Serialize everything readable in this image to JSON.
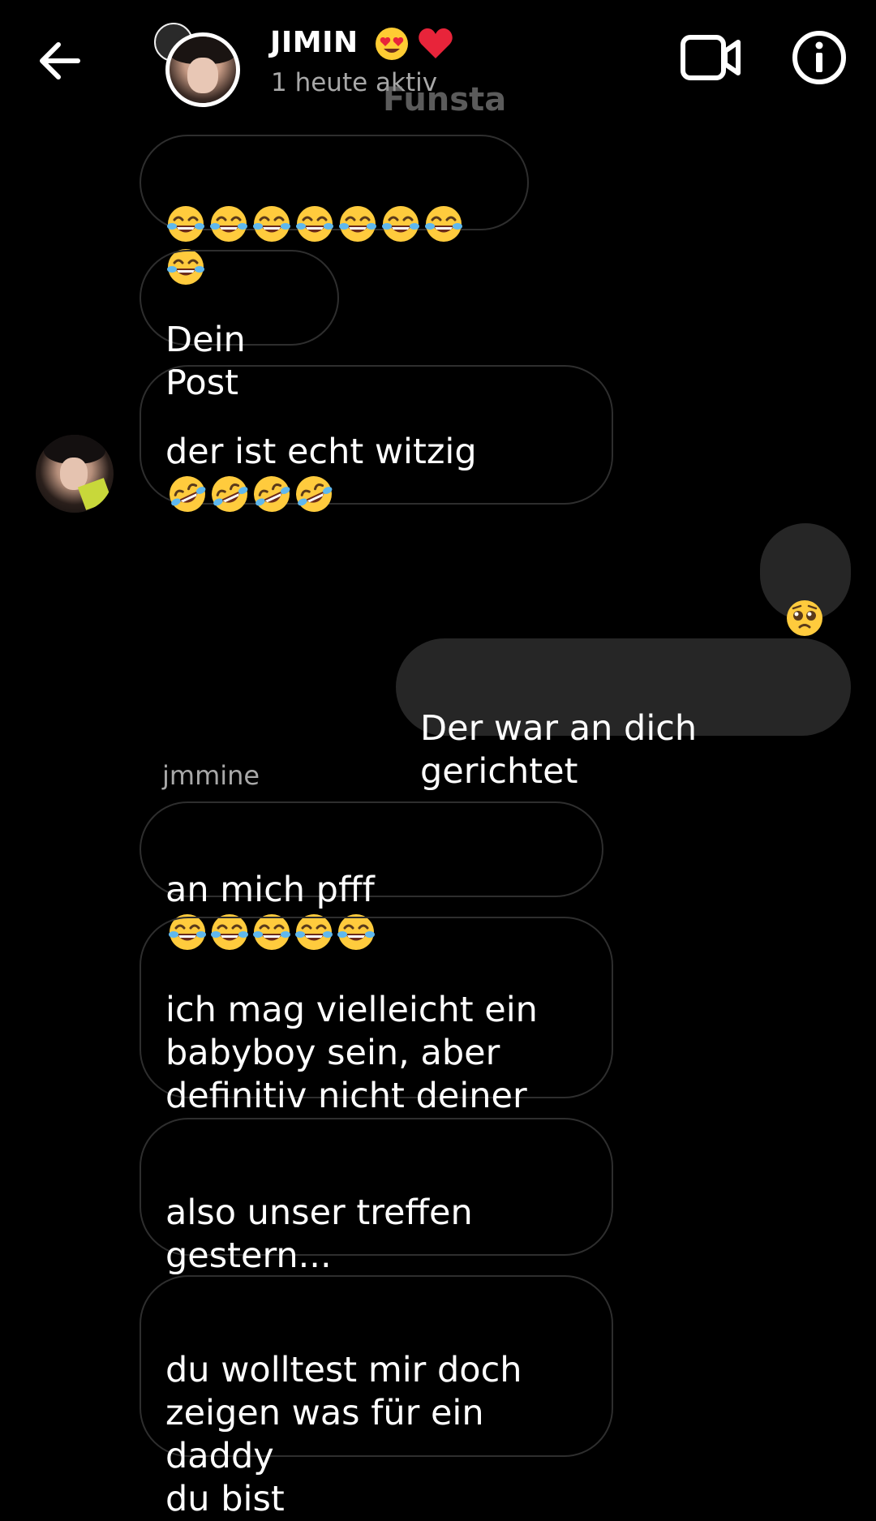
{
  "header": {
    "name": "JIMIN",
    "name_emojis": [
      "smiling-face-with-heart-eyes",
      "red-heart"
    ],
    "status": "1 heute aktiv",
    "watermark": "Funsta"
  },
  "messages": [
    {
      "from": "them",
      "text": "",
      "emojis": [
        "face-with-tears-of-joy",
        "face-with-tears-of-joy",
        "face-with-tears-of-joy",
        "face-with-tears-of-joy",
        "face-with-tears-of-joy",
        "face-with-tears-of-joy",
        "face-with-tears-of-joy",
        "face-with-tears-of-joy"
      ]
    },
    {
      "from": "them",
      "text": "Dein Post"
    },
    {
      "from": "them",
      "text": "der ist echt witzig",
      "emojis": [
        "rolling-on-the-floor-laughing",
        "rolling-on-the-floor-laughing",
        "rolling-on-the-floor-laughing",
        "rolling-on-the-floor-laughing"
      ]
    },
    {
      "from": "me",
      "text": "",
      "emojis": [
        "pleading-face"
      ]
    },
    {
      "from": "me",
      "text": "Der war an dich gerichtet"
    },
    {
      "from": "them",
      "sender": "jmmine",
      "text": "an mich pfff",
      "emojis": [
        "face-with-tears-of-joy",
        "face-with-tears-of-joy",
        "face-with-tears-of-joy",
        "face-with-tears-of-joy",
        "face-with-tears-of-joy"
      ]
    },
    {
      "from": "them",
      "text": "ich mag vielleicht ein\nbabyboy sein, aber\ndefinitiv nicht deiner"
    },
    {
      "from": "them",
      "text": "also unser treffen\ngestern..."
    },
    {
      "from": "them",
      "text": "du wolltest mir doch\nzeigen was für ein daddy\ndu bist"
    }
  ],
  "colors": {
    "background": "#000000",
    "bubble_border": "#2e2e2e",
    "sent_bubble": "#262626",
    "secondary_text": "#a8a8a8"
  },
  "icons": [
    "back-arrow-icon",
    "video-call-icon",
    "info-icon"
  ]
}
